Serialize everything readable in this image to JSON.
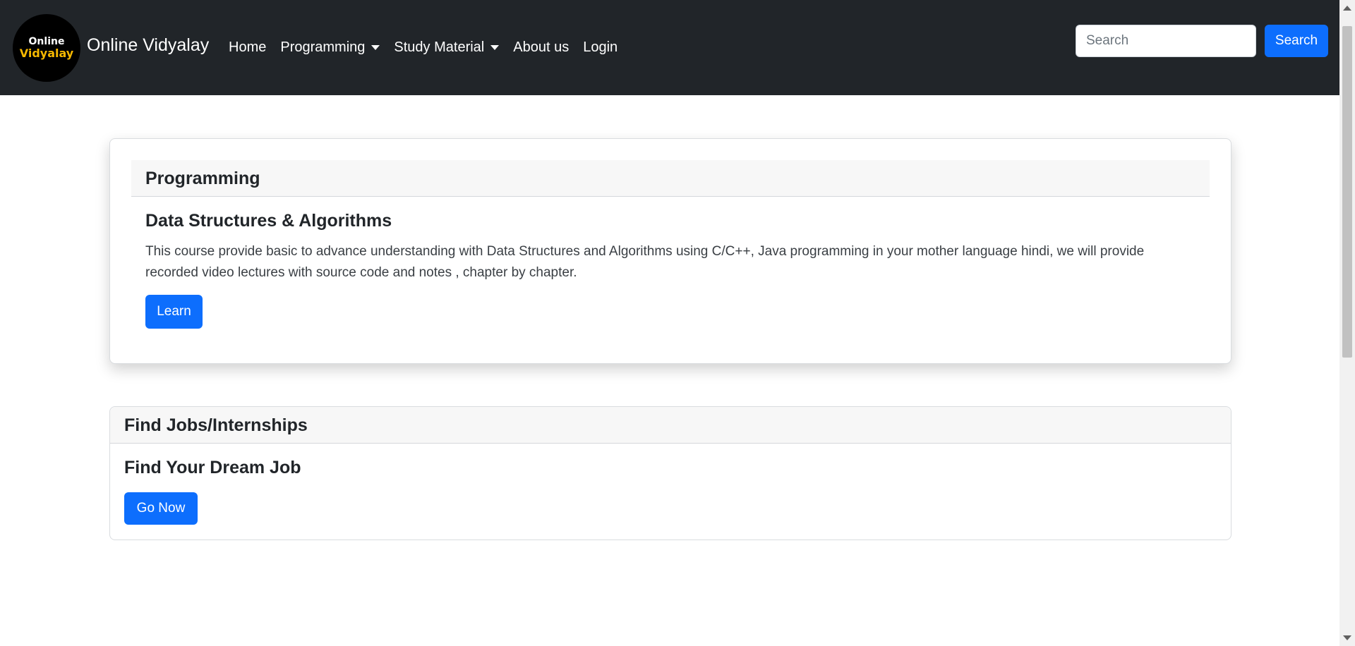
{
  "navbar": {
    "logo_line1": "Online",
    "logo_line2": "Vidyalay",
    "brand": "Online Vidyalay",
    "items": [
      {
        "label": "Home"
      },
      {
        "label": "Programming"
      },
      {
        "label": "Study Material"
      },
      {
        "label": "About us"
      },
      {
        "label": "Login"
      }
    ],
    "search_placeholder": "Search",
    "search_button": "Search"
  },
  "programming_card": {
    "header": "Programming",
    "title": "Data Structures & Algorithms",
    "text": "This course provide basic to advance understanding with Data Structures and Algorithms using C/C++, Java programming in your mother language hindi, we will provide recorded video lectures with source code and notes , chapter by chapter.",
    "button": "Learn"
  },
  "jobs_card": {
    "header": "Find Jobs/Internships",
    "title": "Find Your Dream Job",
    "button": "Go Now"
  },
  "colors": {
    "navbar_bg": "#212529",
    "primary": "#0d6efd",
    "logo_accent": "#f5b800"
  }
}
